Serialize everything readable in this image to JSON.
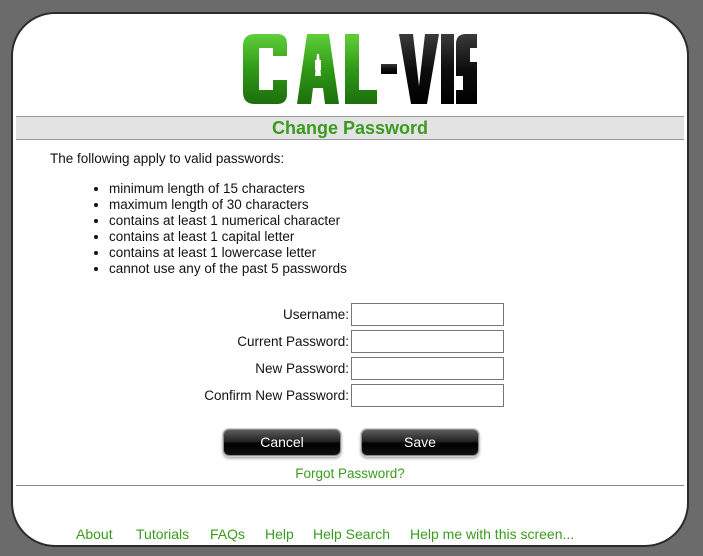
{
  "logo": {
    "text": "CAL-VIS",
    "colors": {
      "green": "#3a9b1e",
      "black": "#111111"
    }
  },
  "page": {
    "title": "Change Password"
  },
  "rules": {
    "intro": "The following apply to valid passwords:",
    "items": [
      "minimum length of 15 characters",
      "maximum length of 30 characters",
      "contains at least 1 numerical character",
      "contains at least 1 capital letter",
      "contains at least 1 lowercase letter",
      "cannot use any of the past 5 passwords"
    ]
  },
  "form": {
    "username_label": "Username:",
    "username_value": "",
    "current_password_label": "Current Password:",
    "current_password_value": "",
    "new_password_label": "New Password:",
    "new_password_value": "",
    "confirm_password_label": "Confirm New Password:",
    "confirm_password_value": ""
  },
  "buttons": {
    "cancel": "Cancel",
    "save": "Save"
  },
  "links": {
    "forgot_password": "Forgot Password?"
  },
  "footer": {
    "links": [
      "About",
      "Tutorials",
      "FAQs",
      "Help",
      "Help Search",
      "Help me with this screen..."
    ]
  },
  "colors": {
    "accent": "#3a9b1e",
    "background": "#6b6b6b",
    "title_band": "#e3e3e3"
  }
}
